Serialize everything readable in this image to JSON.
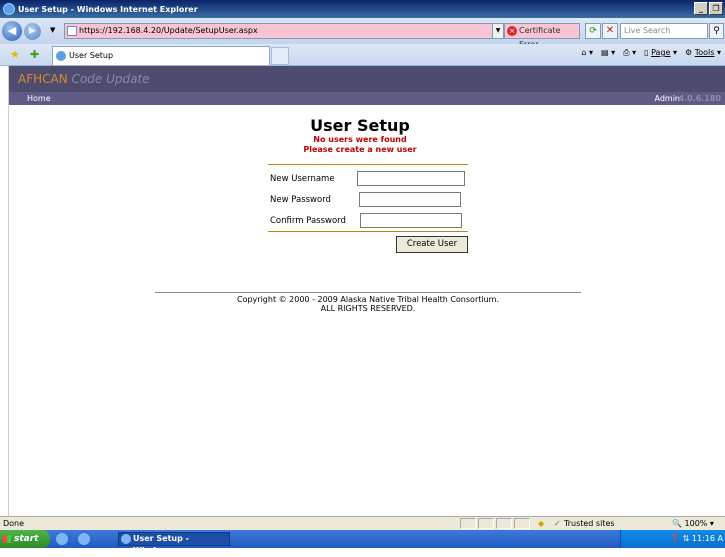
{
  "window": {
    "title": "User Setup - Windows Internet Explorer",
    "min_label": "_",
    "max_label": "❐"
  },
  "browser": {
    "address": "https://192.168.4.20/Update/SetupUser.aspx",
    "cert_error": "Certificate Error",
    "search_placeholder": "Live Search",
    "tab_title": "User Setup",
    "commands": {
      "page": "Page",
      "tools": "Tools"
    }
  },
  "app": {
    "brand": "AFHCAN",
    "brand_sub": "Code Update",
    "nav_home": "Home",
    "nav_admin": "Admin",
    "version": "v4.0.6.180"
  },
  "page": {
    "title": "User Setup",
    "error_line1": "No users were found",
    "error_line2": "Please create a new user",
    "form": {
      "username_label": "New Username",
      "password_label": "New Password",
      "confirm_label": "Confirm Password",
      "username_value": "",
      "password_value": "",
      "confirm_value": "",
      "submit_label": "Create User"
    },
    "copyright_line1": "Copyright © 2000 - 2009 Alaska Native Tribal Health Consortium.",
    "copyright_line2": "ALL RIGHTS RESERVED."
  },
  "status": {
    "text": "Done",
    "zone": "Trusted sites",
    "zoom": "100%"
  },
  "taskbar": {
    "start": "start",
    "task": "User Setup - Windows...",
    "clock": "11:16 A"
  }
}
